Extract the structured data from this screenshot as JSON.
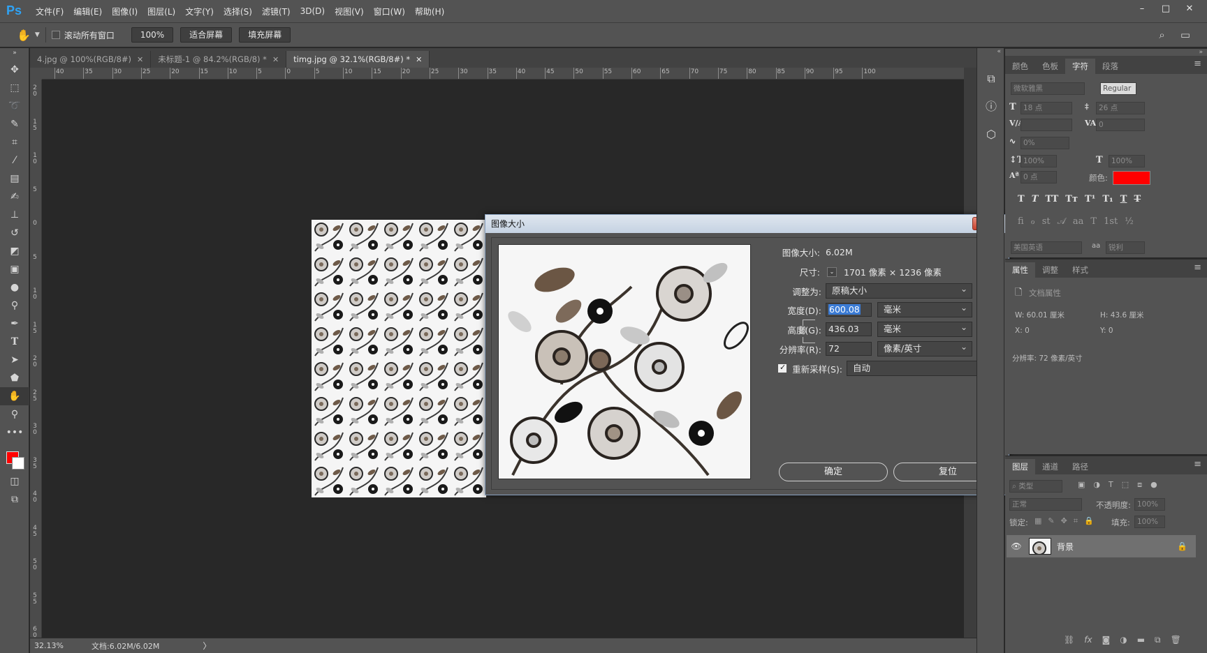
{
  "app": {
    "logo": "Ps"
  },
  "menu": [
    "文件(F)",
    "编辑(E)",
    "图像(I)",
    "图层(L)",
    "文字(Y)",
    "选择(S)",
    "滤镜(T)",
    "3D(D)",
    "视图(V)",
    "窗口(W)",
    "帮助(H)"
  ],
  "window_controls": {
    "minimize": "–",
    "maximize": "□",
    "close": "✕"
  },
  "options": {
    "scroll_all_label": "滚动所有窗口",
    "scroll_all_checked": false,
    "zoom_label": "100%",
    "fit_screen_label": "适合屏幕",
    "fill_screen_label": "填充屏幕"
  },
  "tabs": [
    {
      "label": "4.jpg @ 100%(RGB/8#)",
      "active": false
    },
    {
      "label": "未标题-1 @ 84.2%(RGB/8) *",
      "active": false
    },
    {
      "label": "timg.jpg @ 32.1%(RGB/8#) *",
      "active": true
    }
  ],
  "ruler": {
    "h_ticks": [
      "40",
      "35",
      "30",
      "25",
      "20",
      "15",
      "10",
      "5",
      "0",
      "5",
      "10",
      "15",
      "20",
      "25",
      "30",
      "35",
      "40",
      "45",
      "50",
      "55",
      "60",
      "65",
      "70",
      "75",
      "80",
      "85",
      "90",
      "95",
      "100"
    ],
    "v_ticks": [
      "2 0",
      "1 5",
      "1 0",
      "5",
      "0",
      "5",
      "1 0",
      "1 5",
      "2 0",
      "2 5",
      "3 0",
      "3 5",
      "4 0",
      "4 5",
      "5 0",
      "5 5",
      "6 0"
    ]
  },
  "status": {
    "zoom": "32.13%",
    "doc": "文档:6.02M/6.02M",
    "arrow": "〉"
  },
  "dialog": {
    "title": "图像大小",
    "close": "✕",
    "image_size_label": "图像大小:",
    "image_size_value": "6.02M",
    "dimensions_label": "尺寸:",
    "dimensions_value": "1701 像素 × 1236 像素",
    "fit_to_label": "调整为:",
    "fit_to_value": "原稿大小",
    "width_label": "宽度(D):",
    "width_value": "600.08",
    "width_unit": "毫米",
    "height_label": "高度(G):",
    "height_value": "436.03",
    "height_unit": "毫米",
    "resolution_label": "分辨率(R):",
    "resolution_value": "72",
    "resolution_unit": "像素/英寸",
    "resample_label": "重新采样(S):",
    "resample_checked": true,
    "resample_value": "自动",
    "ok_label": "确定",
    "reset_label": "复位"
  },
  "char_panel": {
    "tabs": [
      "颜色",
      "色板",
      "字符",
      "段落"
    ],
    "active_tab": "字符",
    "font_family": "微软雅黑",
    "font_style": "Regular",
    "font_size": "18 点",
    "leading": "26 点",
    "tracking": "0",
    "scale": "0%",
    "vscale": "100%",
    "hscale": "100%",
    "baseline": "0 点",
    "color_label": "颜色:",
    "color": "#ff0000",
    "language": "美国英语",
    "aa_label": "aa",
    "antialias": "锐利"
  },
  "props_panel": {
    "tabs": [
      "属性",
      "调整",
      "样式"
    ],
    "title": "文档属性",
    "w": "W: 60.01 厘米",
    "h": "H: 43.6 厘米",
    "x": "X: 0",
    "y": "Y: 0",
    "resolution": "分辨率: 72 像素/英寸"
  },
  "layers_panel": {
    "tabs": [
      "图层",
      "通道",
      "路径"
    ],
    "filter_placeholder": "类型",
    "blend_mode": "正常",
    "opacity_label": "不透明度:",
    "opacity": "100%",
    "lock_label": "锁定:",
    "fill_label": "填充:",
    "fill": "100%",
    "layers": [
      {
        "name": "背景",
        "visible": true,
        "locked": true
      }
    ]
  }
}
